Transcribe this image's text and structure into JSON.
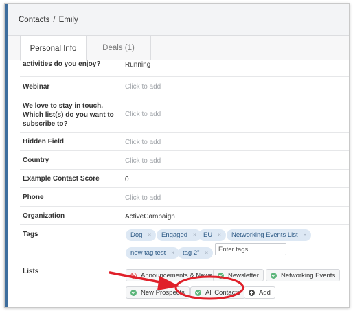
{
  "breadcrumb": {
    "root": "Contacts",
    "separator": "/",
    "current": "Emily"
  },
  "tabs": [
    {
      "label": "Personal Info",
      "active": true
    },
    {
      "label": "Deals (1)",
      "active": false
    }
  ],
  "fields": [
    {
      "label": "activities do you enjoy?",
      "value": "Running",
      "empty": false
    },
    {
      "label": "Webinar",
      "value": "Click to add",
      "empty": true
    },
    {
      "label": "We love to stay in touch. Which list(s) do you want to subscribe to?",
      "value": "Click to add",
      "empty": true
    },
    {
      "label": "Hidden Field",
      "value": "Click to add",
      "empty": true
    },
    {
      "label": "Country",
      "value": "Click to add",
      "empty": true
    },
    {
      "label": "Example Contact Score",
      "value": "0",
      "empty": false
    },
    {
      "label": "Phone",
      "value": "Click to add",
      "empty": true
    },
    {
      "label": "Organization",
      "value": "ActiveCampaign",
      "empty": false
    }
  ],
  "tags": {
    "label": "Tags",
    "items": [
      "Dog",
      "Engaged",
      "EU",
      "Networking Events List",
      "new tag test",
      "tag 2\""
    ],
    "remove_glyph": "×",
    "input_placeholder": "Enter tags..."
  },
  "lists": {
    "label": "Lists",
    "items": [
      {
        "label": "Announcements & News",
        "status": "unsubscribed"
      },
      {
        "label": "Newsletter",
        "status": "subscribed"
      },
      {
        "label": "Networking Events",
        "status": "subscribed"
      },
      {
        "label": "New Prospects",
        "status": "subscribed"
      },
      {
        "label": "All Contacts",
        "status": "subscribed",
        "highlighted": true
      }
    ],
    "add_label": "Add"
  },
  "annotation": {
    "shape": "ellipse",
    "color": "#e0202a",
    "target": "All Contacts"
  },
  "colors": {
    "accent": "#3d6d9d",
    "tag_bg": "#dde8f4",
    "tag_text": "#2f5b86",
    "subscribed": "#5bb57a",
    "unsubscribed": "#e26d6d",
    "annotation": "#e0202a"
  },
  "icons": {
    "subscribed": "check-circle-icon",
    "unsubscribed": "ban-icon",
    "add": "plus-circle-icon"
  }
}
